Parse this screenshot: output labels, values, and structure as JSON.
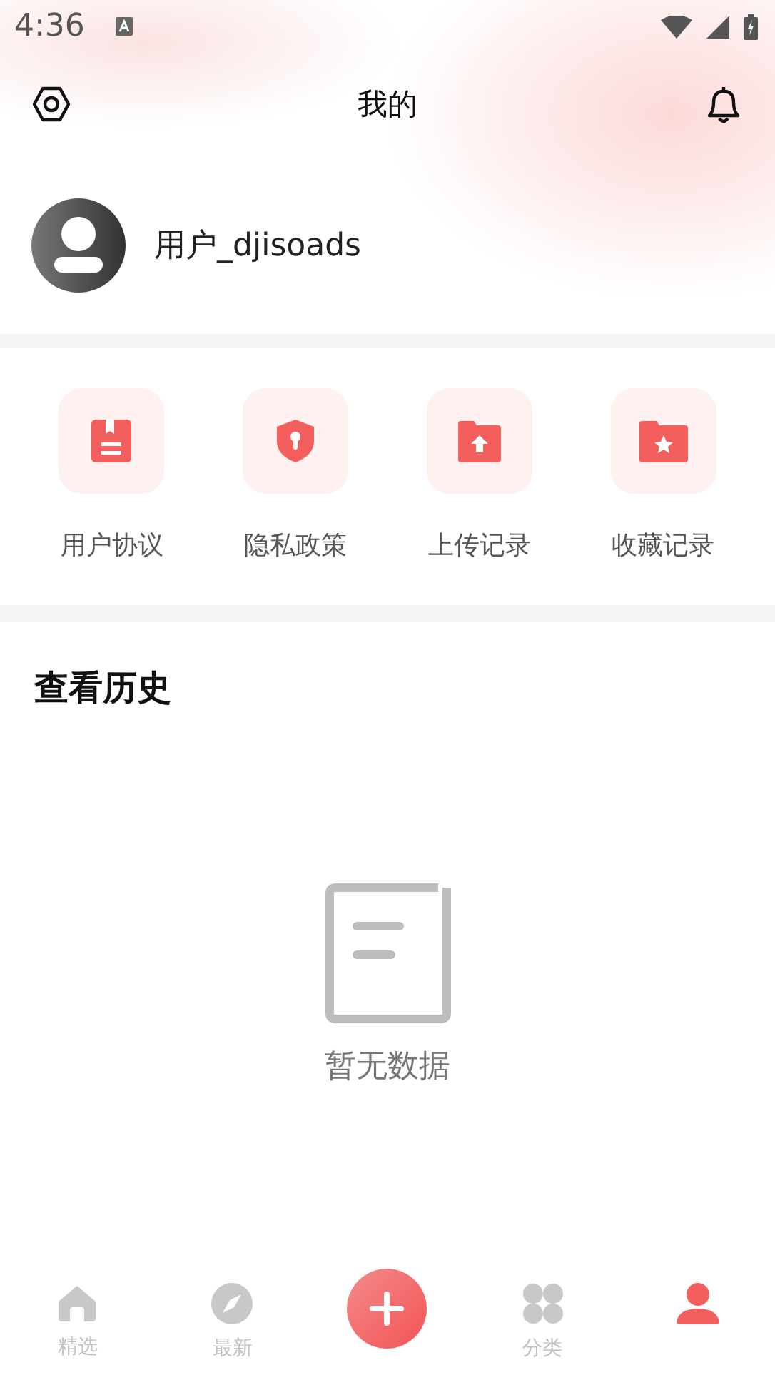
{
  "status_bar": {
    "time": "4:36"
  },
  "header": {
    "title": "我的"
  },
  "profile": {
    "username": "用户_djisoads"
  },
  "shortcuts": [
    {
      "kind": "agreement",
      "label": "用户协议"
    },
    {
      "kind": "privacy",
      "label": "隐私政策"
    },
    {
      "kind": "upload",
      "label": "上传记录"
    },
    {
      "kind": "favorite",
      "label": "收藏记录"
    }
  ],
  "history": {
    "title": "查看历史",
    "empty_text": "暂无数据"
  },
  "bottom_nav": [
    {
      "kind": "home",
      "label": "精选",
      "selected": false
    },
    {
      "kind": "compass",
      "label": "最新",
      "selected": false
    },
    {
      "kind": "add"
    },
    {
      "kind": "category",
      "label": "分类",
      "selected": false
    },
    {
      "kind": "profile",
      "selected": true
    }
  ]
}
